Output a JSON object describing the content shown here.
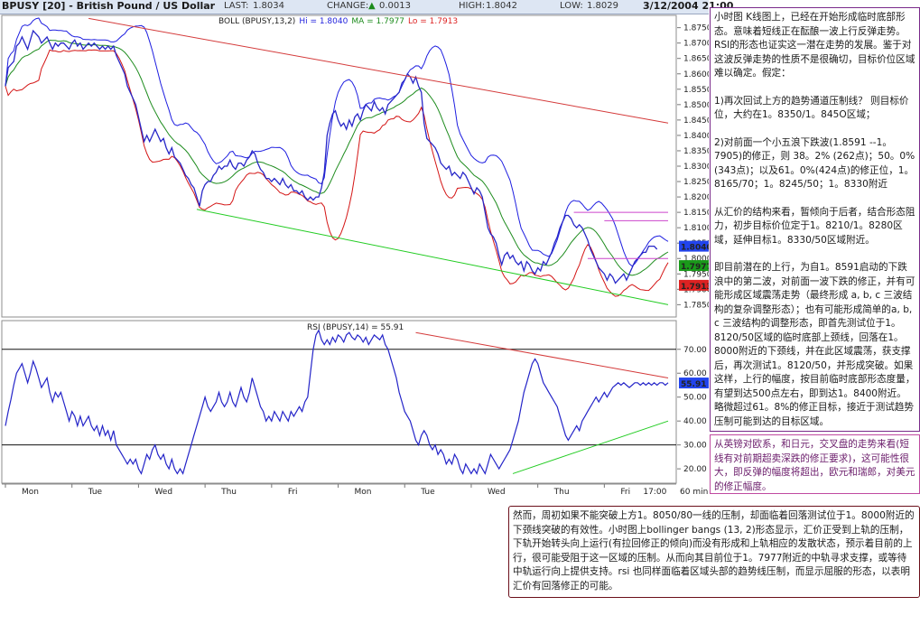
{
  "header": {
    "title": "BPUSY [20] - British Pound / US Dollar",
    "last_label": "LAST:",
    "last_value": "1.8034",
    "change_label": "CHANGE:",
    "change_arrow": "▲",
    "change_value": "0.0013",
    "high_label": "HIGH:",
    "high_value": "1.8042",
    "low_label": "LOW:",
    "low_value": "1.8029",
    "datetime": "3/12/2004 21:00"
  },
  "colors": {
    "price": "#2727c8",
    "boll_band": "#1e1ee0",
    "boll_lower": "#d41515",
    "ma": "#1e8c1e",
    "trend_red": "#d43a3a",
    "trend_green": "#22cc22",
    "magenta": "#cc44cc",
    "badge_blue": "#2244ee",
    "badge_green": "#1a9a1a",
    "badge_red": "#dd2222",
    "rsi": "#2424c8"
  },
  "chart_data": [
    {
      "type": "line",
      "title": "",
      "legend_text": "BOLL (BPUSY,13,2)",
      "hi_label": "Hi = 1.8040",
      "ma_label": "MA = 1.7977",
      "lo_label": "Lo = 1.7913",
      "ylim": [
        1.781,
        1.879
      ],
      "yticks": [
        "1.8750",
        "1.8700",
        "1.8650",
        "1.8600",
        "1.8550",
        "1.8500",
        "1.8450",
        "1.8400",
        "1.8350",
        "1.8300",
        "1.8250",
        "1.8200",
        "1.8150",
        "1.8100",
        "1.8050",
        "1.8000",
        "1.7950",
        "1.7900",
        "1.7850"
      ],
      "badges": [
        {
          "label": "1.8040",
          "value": 1.804,
          "color": "blue"
        },
        {
          "label": "1.7977",
          "value": 1.7977,
          "color": "green"
        },
        {
          "label": "1.7913",
          "value": 1.7913,
          "color": "red"
        }
      ],
      "x_count": 240,
      "series": [
        {
          "role": "price",
          "values": [
            1.856,
            1.862,
            1.863,
            1.864,
            1.869,
            1.87,
            1.872,
            1.87,
            1.868,
            1.871,
            1.874,
            1.873,
            1.872,
            1.87,
            1.871,
            1.872,
            1.87,
            1.868,
            1.87,
            1.869,
            1.87,
            1.87,
            1.869,
            1.868,
            1.87,
            1.871,
            1.869,
            1.87,
            1.868,
            1.869,
            1.87,
            1.869,
            1.87,
            1.869,
            1.868,
            1.869,
            1.868,
            1.869,
            1.868,
            1.869,
            1.866,
            1.864,
            1.862,
            1.86,
            1.856,
            1.854,
            1.852,
            1.85,
            1.846,
            1.842,
            1.838,
            1.84,
            1.838,
            1.84,
            1.842,
            1.84,
            1.838,
            1.839,
            1.836,
            1.834,
            1.836,
            1.833,
            1.832,
            1.831,
            1.829,
            1.827,
            1.826,
            1.824,
            1.823,
            1.82,
            1.817,
            1.822,
            1.824,
            1.825,
            1.825,
            1.827,
            1.828,
            1.83,
            1.829,
            1.83,
            1.83,
            1.832,
            1.83,
            1.829,
            1.831,
            1.831,
            1.83,
            1.832,
            1.833,
            1.835,
            1.834,
            1.831,
            1.829,
            1.828,
            1.826,
            1.826,
            1.825,
            1.826,
            1.825,
            1.824,
            1.826,
            1.824,
            1.823,
            1.824,
            1.822,
            1.822,
            1.821,
            1.822,
            1.82,
            1.819,
            1.82,
            1.819,
            1.82,
            1.82,
            1.823,
            1.828,
            1.84,
            1.844,
            1.847,
            1.848,
            1.845,
            1.843,
            1.844,
            1.842,
            1.845,
            1.843,
            1.846,
            1.847,
            1.845,
            1.848,
            1.85,
            1.849,
            1.848,
            1.851,
            1.849,
            1.848,
            1.849,
            1.847,
            1.85,
            1.851,
            1.852,
            1.853,
            1.854,
            1.857,
            1.858,
            1.86,
            1.859,
            1.857,
            1.859,
            1.856,
            1.854,
            1.844,
            1.839,
            1.838,
            1.837,
            1.836,
            1.834,
            1.831,
            1.83,
            1.829,
            1.83,
            1.827,
            1.828,
            1.827,
            1.826,
            1.828,
            1.827,
            1.825,
            1.823,
            1.821,
            1.823,
            1.822,
            1.82,
            1.815,
            1.81,
            1.808,
            1.807,
            1.805,
            1.801,
            1.798,
            1.801,
            1.802,
            1.8,
            1.801,
            1.799,
            1.798,
            1.799,
            1.796,
            1.799,
            1.798,
            1.796,
            1.795,
            1.797,
            1.796,
            1.799,
            1.798,
            1.8,
            1.802,
            1.805,
            1.807,
            1.81,
            1.812,
            1.814,
            1.814,
            1.813,
            1.811,
            1.81,
            1.811,
            1.81,
            1.808,
            1.806,
            1.803,
            1.801,
            1.799,
            1.797,
            1.796,
            1.795,
            1.793,
            1.795,
            1.794,
            1.792,
            1.793,
            1.794,
            1.795,
            1.793,
            1.795,
            1.797,
            1.799,
            1.8,
            1.801,
            1.802,
            1.802,
            1.804,
            1.804,
            1.804,
            1.803
          ]
        }
      ]
    },
    {
      "type": "line",
      "title": "",
      "legend_text": "RSI (BPUSY,14) = 55.91",
      "ylim": [
        14,
        82
      ],
      "yticks": [
        "70.00",
        "60.00",
        "50.00",
        "40.00",
        "30.00",
        "20.00"
      ],
      "badge": {
        "label": "55.91",
        "value": 55.91
      },
      "hlines": [
        70,
        30
      ],
      "x_count": 240,
      "series": [
        {
          "role": "rsi",
          "values": [
            38,
            44,
            49,
            55,
            60,
            62,
            64,
            60,
            56,
            60,
            65,
            62,
            58,
            54,
            56,
            58,
            52,
            48,
            52,
            50,
            52,
            48,
            44,
            40,
            44,
            42,
            38,
            42,
            38,
            40,
            42,
            38,
            36,
            38,
            34,
            38,
            34,
            36,
            32,
            36,
            30,
            28,
            26,
            24,
            22,
            24,
            22,
            24,
            20,
            18,
            22,
            26,
            24,
            28,
            30,
            26,
            24,
            26,
            22,
            20,
            24,
            20,
            18,
            20,
            18,
            22,
            26,
            30,
            34,
            38,
            42,
            46,
            50,
            46,
            44,
            46,
            48,
            52,
            48,
            46,
            48,
            52,
            48,
            46,
            50,
            54,
            50,
            48,
            52,
            58,
            54,
            50,
            46,
            44,
            40,
            42,
            40,
            44,
            42,
            40,
            44,
            42,
            40,
            44,
            42,
            44,
            46,
            44,
            48,
            50,
            60,
            70,
            76,
            78,
            74,
            72,
            74,
            72,
            75,
            73,
            76,
            75,
            73,
            76,
            77,
            75,
            74,
            76,
            75,
            73,
            75,
            72,
            74,
            76,
            75,
            74,
            76,
            72,
            70,
            66,
            62,
            58,
            52,
            48,
            44,
            42,
            40,
            36,
            32,
            30,
            34,
            36,
            34,
            30,
            28,
            30,
            26,
            28,
            26,
            22,
            24,
            22,
            26,
            24,
            20,
            18,
            22,
            20,
            18,
            20,
            18,
            22,
            20,
            18,
            22,
            26,
            24,
            22,
            20,
            22,
            24,
            26,
            28,
            32,
            36,
            40,
            46,
            52,
            56,
            60,
            64,
            66,
            64,
            60,
            56,
            54,
            52,
            50,
            48,
            46,
            42,
            38,
            34,
            32,
            34,
            36,
            38,
            36,
            40,
            42,
            44,
            46,
            48,
            50,
            48,
            50,
            52,
            50,
            52,
            54,
            55,
            56,
            55,
            56,
            55,
            54,
            55,
            56,
            56,
            55,
            56,
            55,
            56,
            55,
            56,
            55,
            56,
            56,
            55,
            56
          ]
        }
      ]
    }
  ],
  "x_axis": {
    "day_labels": [
      "Mon",
      "Tue",
      "Wed",
      "Thu",
      "Fri",
      "Mon",
      "Tue",
      "Wed",
      "Thu",
      "Fri"
    ],
    "time_label": "17:00",
    "interval_label": "60 min"
  },
  "annotations": {
    "box1": [
      "小时图 K线图上，已经在开始形成临时底部形态。意味着短线正在酝酿一波上行反弹走势。RSI的形态也证实这一潜在走势的发展。鉴于对这波反弹走势的性质不是很确切，目标价位区域难以确定。假定：",
      "1)再次回试上方的趋势通道压制线？ 则目标价位，大约在1。8350/1。845O区域；",
      "2)对前面一个小五浪下跌波(1.8591 --1。7905)的修正，则 38。2% (262点)；50。0%(343点)；以及61。0%(424点)的修正位，1。8165/70；1。8245/50；1。8330附近",
      "从汇价的结构来看，暂倾向于后者，结合形态阻力，初步目标价位定于1。8210/1。8280区域，延伸目标1。8330/50区域附近。",
      "即目前潜在的上行，为自1。8591启动的下跌浪中的第二波，对前面一波下跌的修正，并有可能形成区域震荡走势（最终形成 a, b, c 三波结构的复杂调整形态）；也有可能形成简单的a, b, c 三波结构的调整形态，即首先测试位于1。8120/50区域的临时底部上颈线，回落在1。8000附近的下颈线，并在此区域震荡，获支撑后，再次测试1。8120/50，并形成突破。如果这样，上行的幅度，按目前临时底部形态度量，有望到达500点左右，即到达1。8400附近。略微超过61。8%的修正目标，接近于测试趋势压制可能到达的目标区域。"
    ],
    "box2": "从英镑对欧系，和日元，交叉盘的走势来看(短线有对前期超卖深跌的修正要求)，这可能性很大，即反弹的幅度将超出，欧元和瑞郎，对美元的修正幅度。",
    "box3": "然而，周初如果不能突破上方1。8050/80一线的压制，却面临着回落测试位于1。8000附近的下颈线突破的有效性。小时图上bollinger bangs (13, 2)形态显示，汇价正受到上轨的压制，下轨开始转头向上运行(有拉回修正的倾向)而没有形成和上轨相应的发散状态，预示着目前的上行，很可能受阻于这一区域的压制。从而向其目前位于1。7977附近的中轨寻求支撑，或等待中轨运行向上提供支持。rsi 也同样面临着区域头部的趋势线压制，而显示屈服的形态，以表明汇价有回落修正的可能。"
  }
}
